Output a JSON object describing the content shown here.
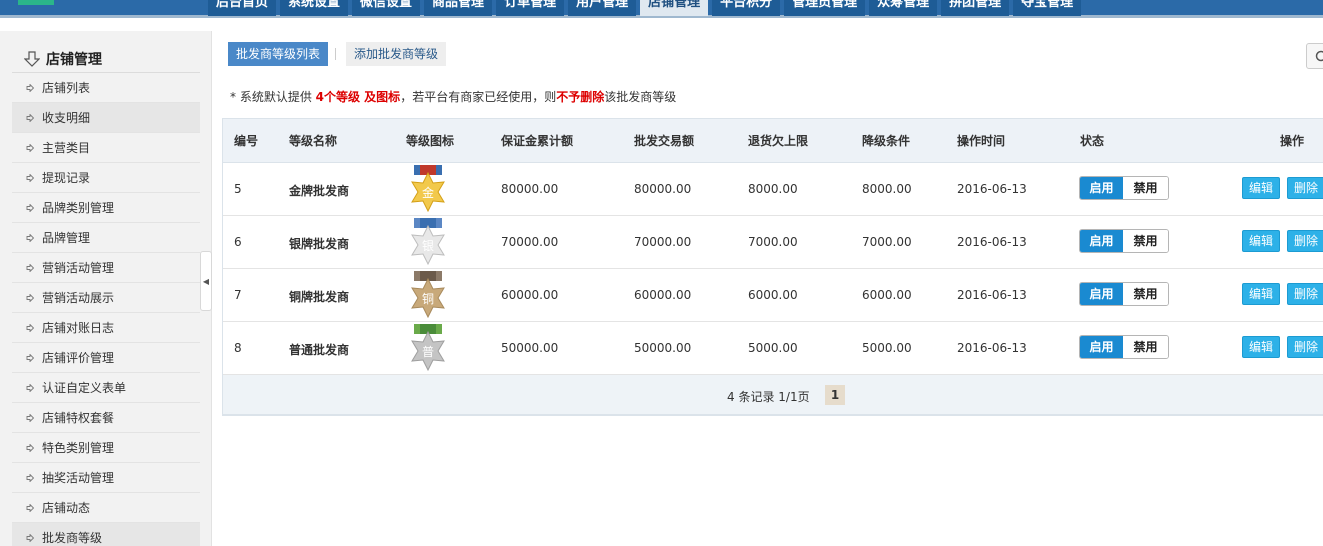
{
  "topnav": {
    "tabs": [
      {
        "label": "后台首页"
      },
      {
        "label": "系统设置"
      },
      {
        "label": "微信设置"
      },
      {
        "label": "商品管理"
      },
      {
        "label": "订单管理"
      },
      {
        "label": "用户管理"
      },
      {
        "label": "店铺管理",
        "active": true
      },
      {
        "label": "平台积分"
      },
      {
        "label": "管理员管理"
      },
      {
        "label": "众筹管理"
      },
      {
        "label": "拼团管理"
      },
      {
        "label": "夺宝管理"
      }
    ]
  },
  "sidebar": {
    "title": "店铺管理",
    "items": [
      {
        "label": "店铺列表"
      },
      {
        "label": "收支明细",
        "highlight": true
      },
      {
        "label": "主营类目"
      },
      {
        "label": "提现记录"
      },
      {
        "label": "品牌类别管理"
      },
      {
        "label": "品牌管理"
      },
      {
        "label": "营销活动管理"
      },
      {
        "label": "营销活动展示"
      },
      {
        "label": "店铺对账日志"
      },
      {
        "label": "店铺评价管理"
      },
      {
        "label": "认证自定义表单"
      },
      {
        "label": "店铺特权套餐"
      },
      {
        "label": "特色类别管理"
      },
      {
        "label": "抽奖活动管理"
      },
      {
        "label": "店铺动态"
      },
      {
        "label": "批发商等级",
        "highlight": true
      }
    ]
  },
  "subtabs": {
    "list": "批发商等级列表",
    "add": "添加批发商等级"
  },
  "notice": {
    "prefix": "* 系统默认提供",
    "highlight1": "4个等级 及图标",
    "middle": "，若平台有商家已经使用，则",
    "highlight2": "不予删除",
    "suffix": "该批发商等级"
  },
  "table": {
    "headers": {
      "id": "编号",
      "name": "等级名称",
      "icon": "等级图标",
      "deposit": "保证金累计额",
      "volume": "批发交易额",
      "debt": "退货欠上限",
      "downgrade": "降级条件",
      "time": "操作时间",
      "status": "状态",
      "ops": "操作"
    },
    "rows": [
      {
        "id": "5",
        "name": "金牌批发商",
        "medal": "金",
        "deposit": "80000.00",
        "volume": "80000.00",
        "debt": "8000.00",
        "downgrade": "8000.00",
        "time": "2016-06-13",
        "on": "启用",
        "off": "禁用",
        "edit": "编辑",
        "del": "删除"
      },
      {
        "id": "6",
        "name": "银牌批发商",
        "medal": "银",
        "deposit": "70000.00",
        "volume": "70000.00",
        "debt": "7000.00",
        "downgrade": "7000.00",
        "time": "2016-06-13",
        "on": "启用",
        "off": "禁用",
        "edit": "编辑",
        "del": "删除"
      },
      {
        "id": "7",
        "name": "铜牌批发商",
        "medal": "铜",
        "deposit": "60000.00",
        "volume": "60000.00",
        "debt": "6000.00",
        "downgrade": "6000.00",
        "time": "2016-06-13",
        "on": "启用",
        "off": "禁用",
        "edit": "编辑",
        "del": "删除"
      },
      {
        "id": "8",
        "name": "普通批发商",
        "medal": "普",
        "deposit": "50000.00",
        "volume": "50000.00",
        "debt": "5000.00",
        "downgrade": "5000.00",
        "time": "2016-06-13",
        "on": "启用",
        "off": "禁用",
        "edit": "编辑",
        "del": "删除"
      }
    ]
  },
  "pager": {
    "info": "4 条记录 1/1页",
    "current": "1"
  },
  "colors": {
    "nav_bg": "#2b6aa8",
    "accent": "#1a8ad1",
    "alert_red": "#dd0000",
    "medal_gold": "#f2c94c",
    "medal_silver": "#d9d9d9",
    "medal_bronze": "#c8a97a",
    "medal_normal": "#bdbdbd"
  }
}
